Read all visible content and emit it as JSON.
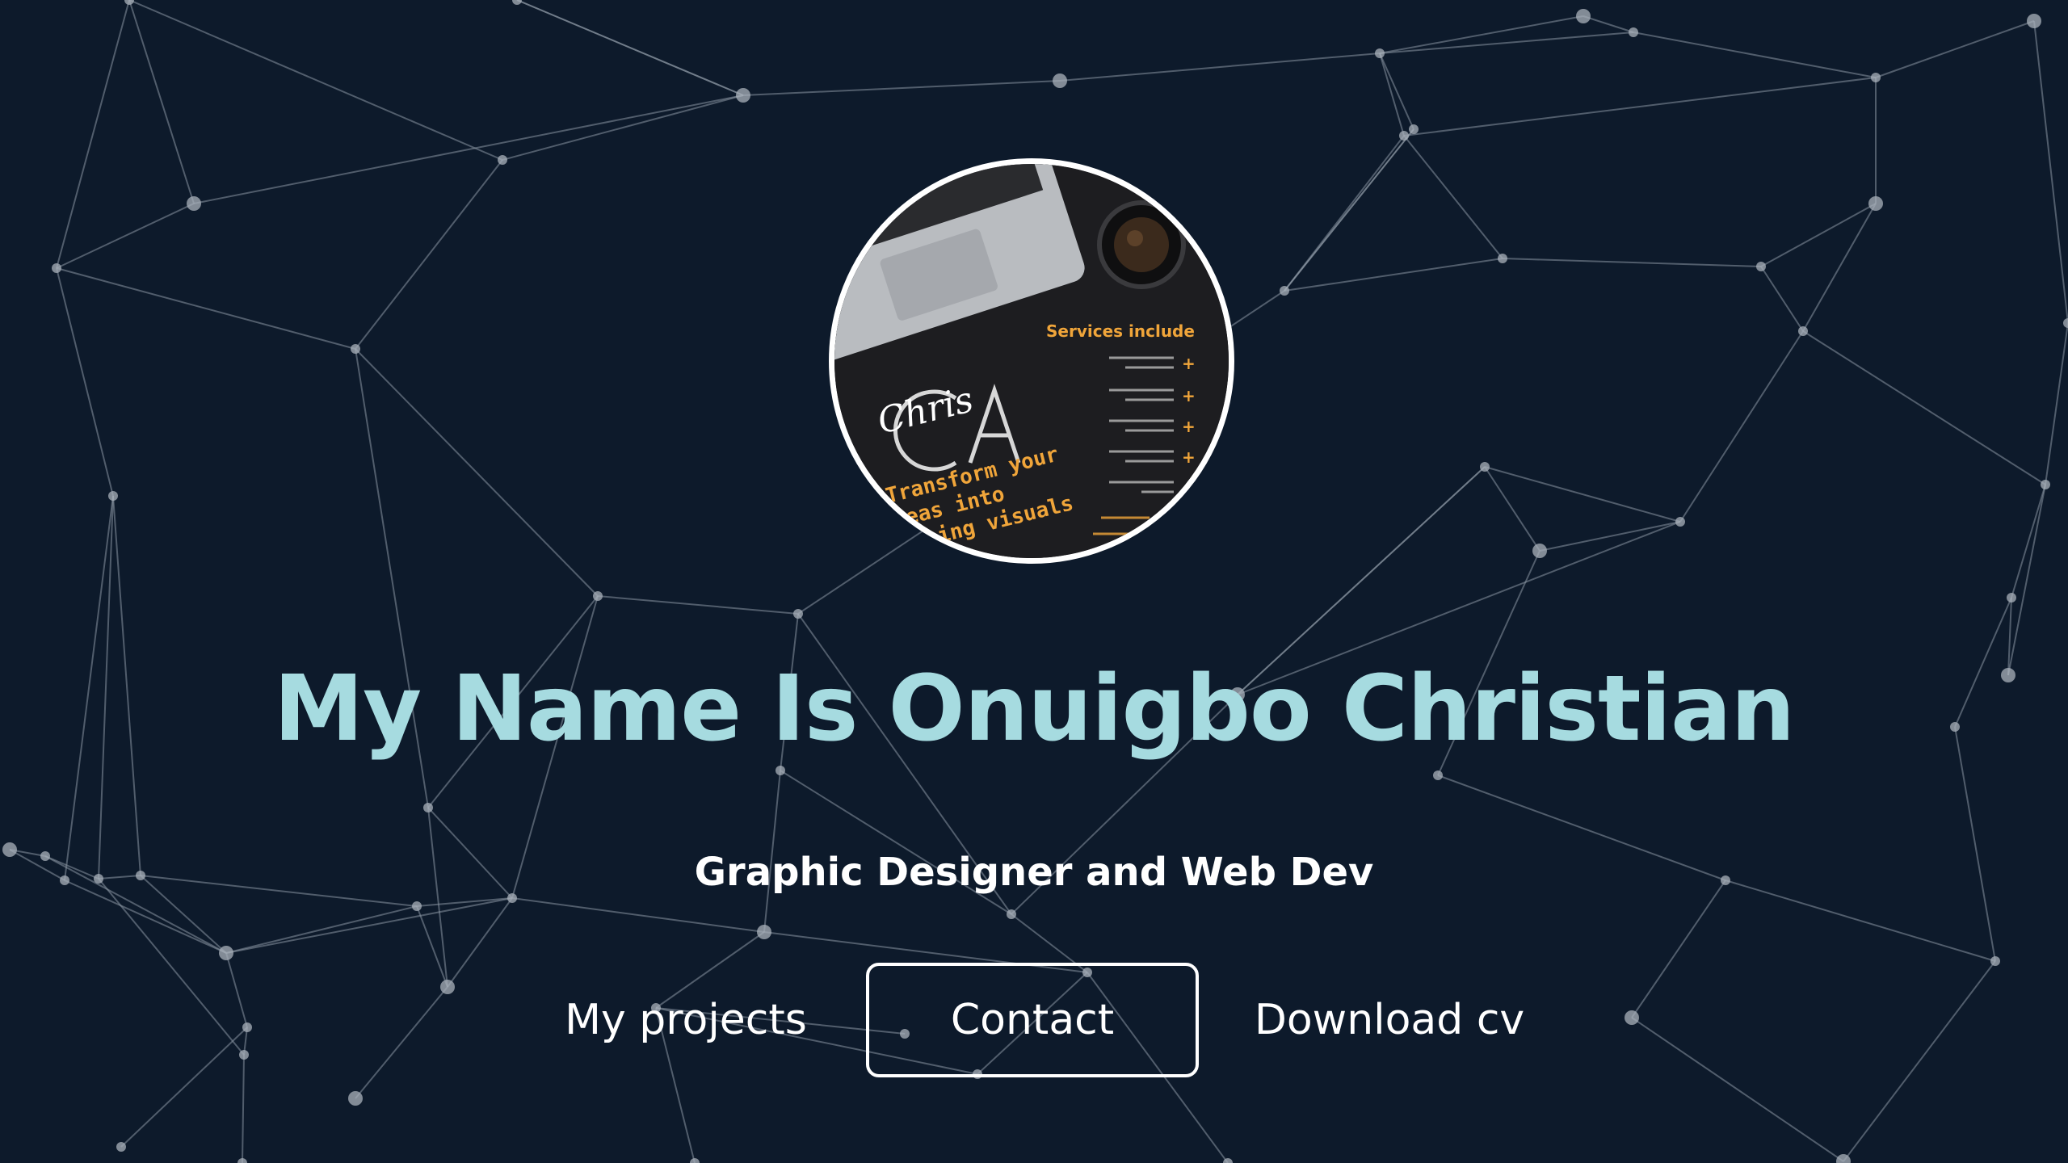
{
  "colors": {
    "background": "#0d1a2b",
    "title": "#a6dbe0",
    "text": "#ffffff",
    "network_lines": "#8a95a3",
    "network_nodes": "#a9b1bb",
    "avatar_accent": "#f0a53a"
  },
  "background": {
    "icon": "particle-network"
  },
  "avatar": {
    "icon": "profile-flyer-image",
    "flyer": {
      "heading": "Services include",
      "tagline_lines": [
        "Transform your",
        "ideas into",
        "stunning visuals"
      ],
      "signature": "Chris"
    }
  },
  "hero": {
    "title": "My Name Is Onuigbo Christian",
    "subtitle": "Graphic Designer and Web Dev"
  },
  "actions": {
    "projects_label": "My projects",
    "contact_label": "Contact",
    "download_label": "Download cv"
  }
}
